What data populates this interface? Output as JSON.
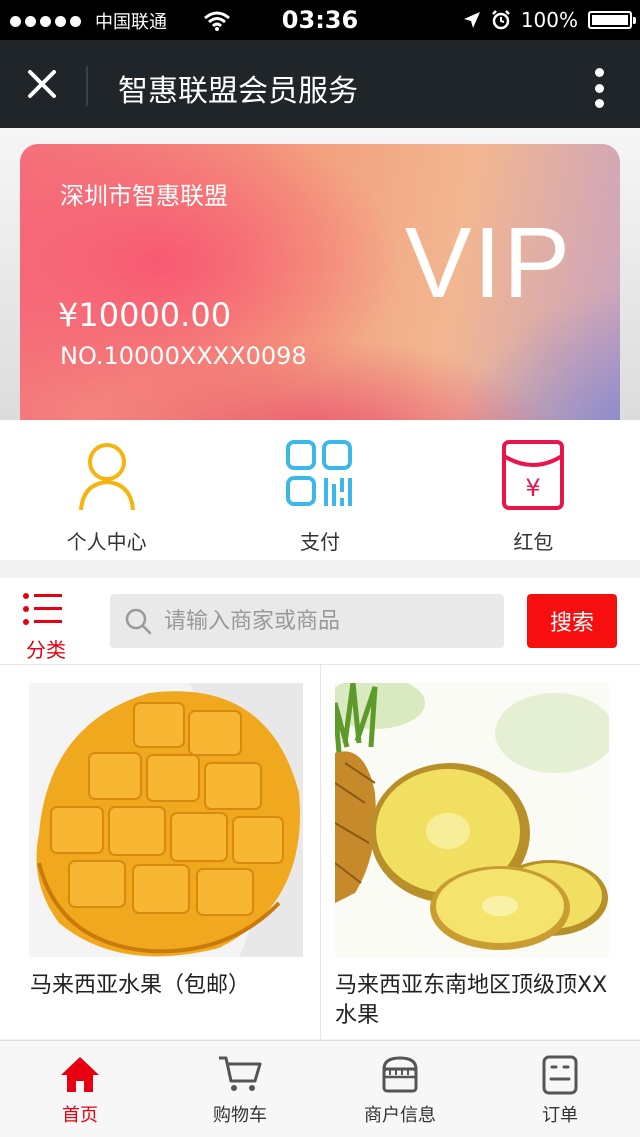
{
  "status_bar": {
    "carrier": "中国联通",
    "time": "03:36",
    "battery": "100%"
  },
  "navbar": {
    "title": "智惠联盟会员服务",
    "close_icon": "close-icon",
    "more_icon": "more-vertical-icon"
  },
  "card": {
    "organization": "深圳市智惠联盟",
    "level": "VIP",
    "balance": "¥10000.00",
    "card_number": "NO.10000XXXX0098"
  },
  "quick_actions": [
    {
      "label": "个人中心",
      "icon": "person-icon",
      "color": "#f5b40f"
    },
    {
      "label": "支付",
      "icon": "pay-grid-icon",
      "color": "#3cb8e8"
    },
    {
      "label": "红包",
      "icon": "red-envelope-icon",
      "color": "#e8154d"
    }
  ],
  "search": {
    "category_label": "分类",
    "placeholder": "请输入商家或商品",
    "button_label": "搜索",
    "accent": "#f70f0f"
  },
  "products": [
    {
      "name": "马来西亚水果（包邮）",
      "image": "mango"
    },
    {
      "name": "马来西亚东南地区顶级顶XX水果",
      "image": "pineapple"
    }
  ],
  "tab_bar": [
    {
      "label": "首页",
      "icon": "home-icon",
      "active": true
    },
    {
      "label": "购物车",
      "icon": "cart-icon",
      "active": false
    },
    {
      "label": "商户信息",
      "icon": "store-icon",
      "active": false
    },
    {
      "label": "订单",
      "icon": "order-icon",
      "active": false
    }
  ]
}
